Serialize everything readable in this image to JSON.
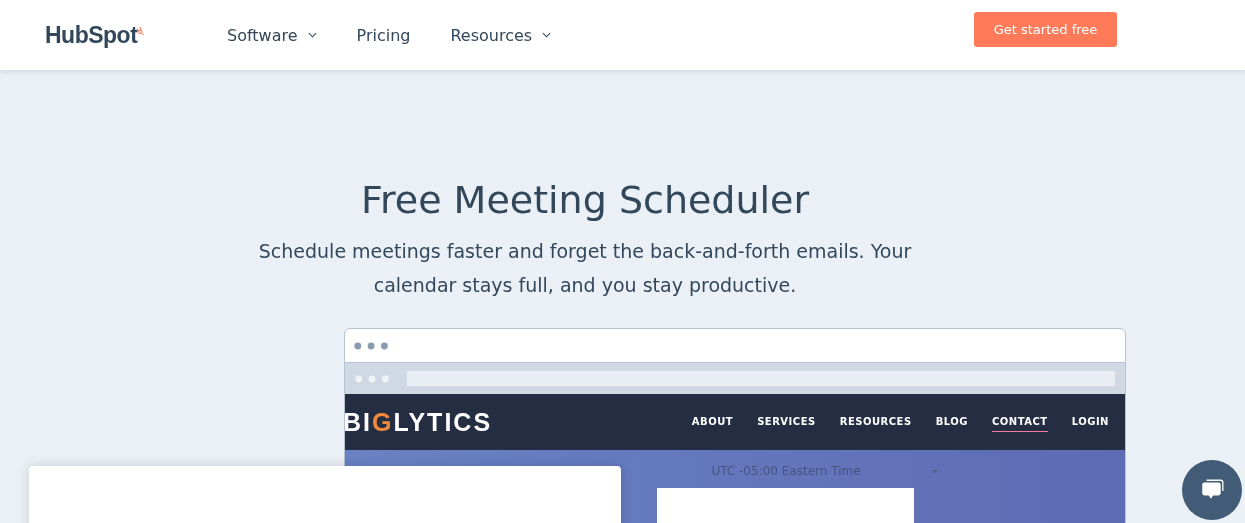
{
  "header": {
    "logo": "HubSpot",
    "nav": [
      {
        "label": "Software",
        "has_menu": true
      },
      {
        "label": "Pricing",
        "has_menu": false
      },
      {
        "label": "Resources",
        "has_menu": true
      }
    ],
    "cta": "Get started free"
  },
  "hero": {
    "title": "Free Meeting Scheduler",
    "subtitle": "Schedule meetings faster and forget the back-and-forth emails. Your calendar stays full, and you stay productive."
  },
  "mockup": {
    "logo": "BIGLYTICS",
    "nav": [
      {
        "label": "ABOUT",
        "selected": false
      },
      {
        "label": "SERVICES",
        "selected": false
      },
      {
        "label": "RESOURCES",
        "selected": false
      },
      {
        "label": "BLOG",
        "selected": false
      },
      {
        "label": "CONTACT",
        "selected": true
      },
      {
        "label": "LOGIN",
        "selected": false
      }
    ],
    "timezone": "UTC -05:00 Eastern Time"
  }
}
